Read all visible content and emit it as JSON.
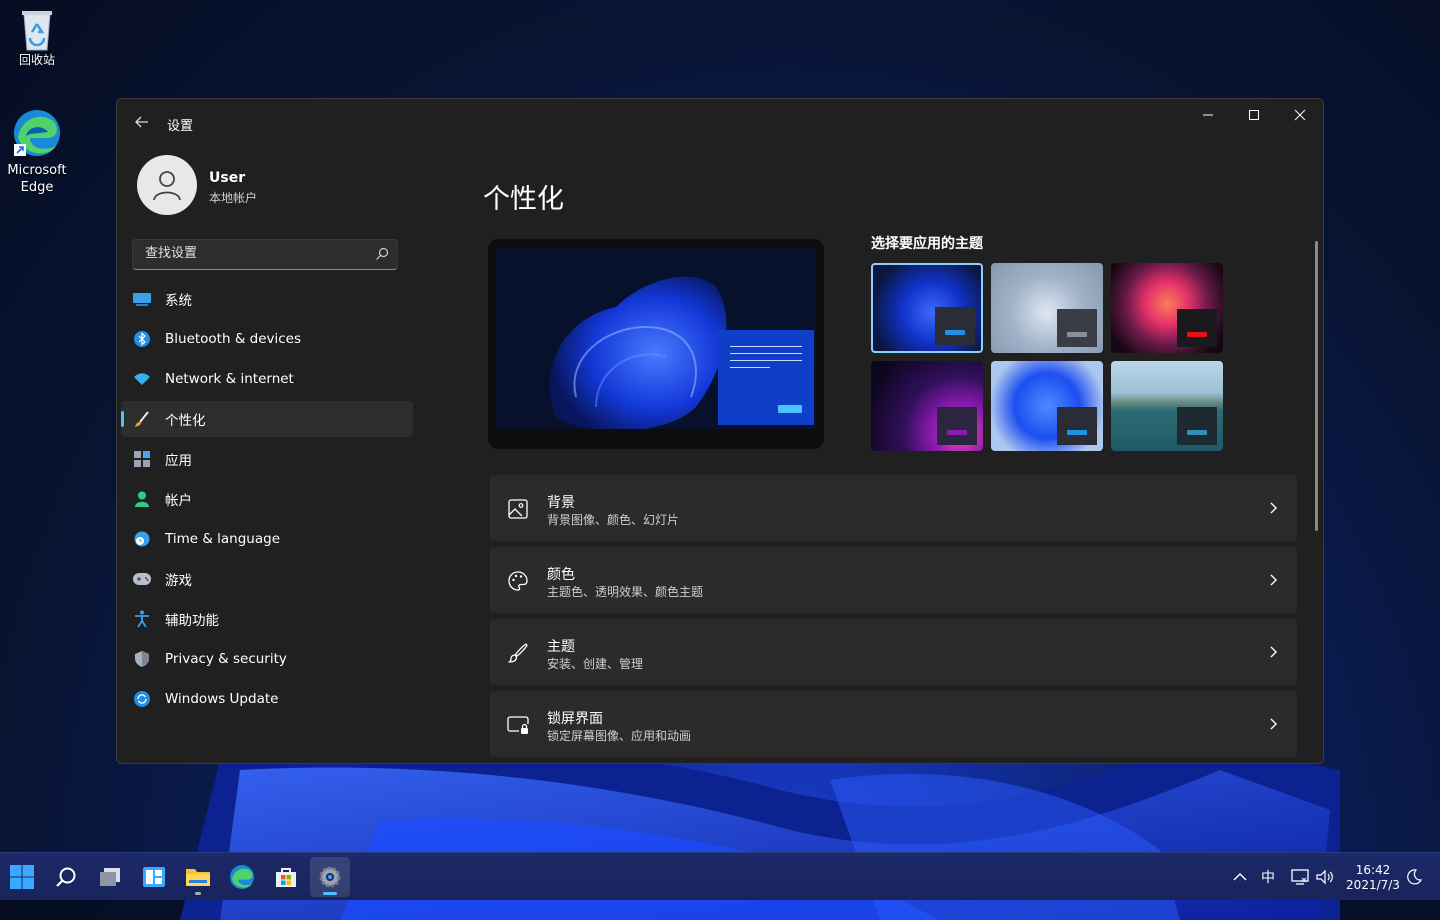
{
  "desktop": {
    "icons": [
      {
        "label": "回收站"
      },
      {
        "label": "Microsoft Edge"
      }
    ]
  },
  "window": {
    "title": "设置",
    "user": {
      "name": "User",
      "account_type": "本地帐户"
    },
    "search": {
      "placeholder": "查找设置"
    },
    "nav": [
      {
        "label": "系统",
        "icon": "system-icon"
      },
      {
        "label": "Bluetooth & devices",
        "icon": "bluetooth-icon"
      },
      {
        "label": "Network & internet",
        "icon": "wifi-icon"
      },
      {
        "label": "个性化",
        "icon": "brush-icon",
        "active": true
      },
      {
        "label": "应用",
        "icon": "apps-icon"
      },
      {
        "label": "帐户",
        "icon": "account-icon"
      },
      {
        "label": "Time & language",
        "icon": "clock-globe-icon"
      },
      {
        "label": "游戏",
        "icon": "gamepad-icon"
      },
      {
        "label": "辅助功能",
        "icon": "accessibility-icon"
      },
      {
        "label": "Privacy & security",
        "icon": "shield-icon"
      },
      {
        "label": "Windows Update",
        "icon": "update-icon"
      }
    ],
    "page_title": "个性化",
    "themes": {
      "heading": "选择要应用的主题",
      "selected_index": 0
    },
    "settings_rows": [
      {
        "title": "背景",
        "subtitle": "背景图像、颜色、幻灯片",
        "icon": "picture-icon"
      },
      {
        "title": "颜色",
        "subtitle": "主题色、透明效果、颜色主题",
        "icon": "palette-icon"
      },
      {
        "title": "主题",
        "subtitle": "安装、创建、管理",
        "icon": "brush-icon"
      },
      {
        "title": "锁屏界面",
        "subtitle": "锁定屏幕图像、应用和动画",
        "icon": "lock-screen-icon"
      }
    ]
  },
  "taskbar": {
    "tray": {
      "ime": "中"
    },
    "clock": {
      "time": "16:42",
      "date": "2021/7/3"
    }
  },
  "colors": {
    "accent": "#4cc2ff",
    "window_bg": "#202020",
    "card_bg": "#2b2b2b"
  }
}
